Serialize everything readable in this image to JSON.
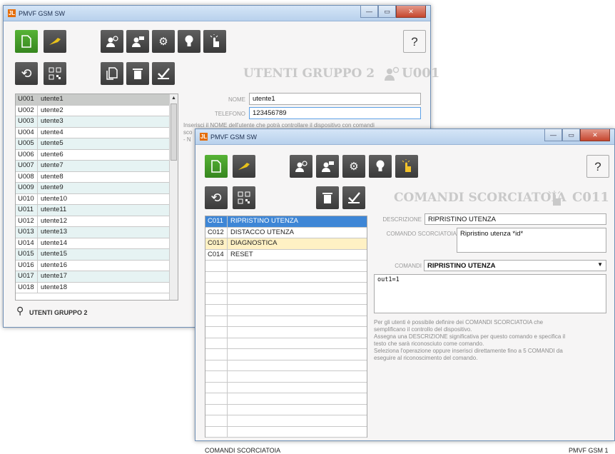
{
  "window1": {
    "title": "PMVF GSM SW",
    "section_title": "UTENTI GRUPPO 2",
    "section_code": "U001",
    "nome_label": "NOME",
    "nome_value": "utente1",
    "telefono_label": "TELEFONO",
    "telefono_value": "123456789",
    "hint_line1": "Inserisci il NOME dell'utente che potrà controllare il dispositivo con comandi",
    "hint_line2": "sco",
    "hint_line3": "- N",
    "footer": "UTENTI GRUPPO 2",
    "users": [
      {
        "code": "U001",
        "name": "utente1"
      },
      {
        "code": "U002",
        "name": "utente2"
      },
      {
        "code": "U003",
        "name": "utente3"
      },
      {
        "code": "U004",
        "name": "utente4"
      },
      {
        "code": "U005",
        "name": "utente5"
      },
      {
        "code": "U006",
        "name": "utente6"
      },
      {
        "code": "U007",
        "name": "utente7"
      },
      {
        "code": "U008",
        "name": "utente8"
      },
      {
        "code": "U009",
        "name": "utente9"
      },
      {
        "code": "U010",
        "name": "utente10"
      },
      {
        "code": "U011",
        "name": "utente11"
      },
      {
        "code": "U012",
        "name": "utente12"
      },
      {
        "code": "U013",
        "name": "utente13"
      },
      {
        "code": "U014",
        "name": "utente14"
      },
      {
        "code": "U015",
        "name": "utente15"
      },
      {
        "code": "U016",
        "name": "utente16"
      },
      {
        "code": "U017",
        "name": "utente17"
      },
      {
        "code": "U018",
        "name": "utente18"
      }
    ]
  },
  "window2": {
    "title": "PMVF GSM SW",
    "section_title": "COMANDI SCORCIATOIA",
    "section_code": "C011",
    "descrizione_label": "DESCRIZIONE",
    "descrizione_value": "RIPRISTINO UTENZA",
    "comando_label": "COMANDO SCORCIATOIA",
    "comando_value": "Ripristino utenza *id*",
    "comandi_label": "COMANDI",
    "comandi_value": "RIPRISTINO UTENZA",
    "commands_text": "out1=1",
    "info_lines": [
      "Per gli utenti è possibile definire dei COMANDI SCORCIATOIA che",
      "semplificano il controllo del dispositivo.",
      "Assegna una DESCRIZIONE significativa per questo comando e specifica il",
      "testo che sarà riconosciuto come comando.",
      "Seleziona l'operazione oppure inserisci direttamente fino a 5 COMANDI da",
      "eseguire al riconoscimento del comando."
    ],
    "footer_left": "COMANDI SCORCIATOIA",
    "footer_right": "PMVF GSM 1",
    "commands": [
      {
        "code": "C011",
        "name": "RIPRISTINO UTENZA"
      },
      {
        "code": "C012",
        "name": "DISTACCO UTENZA"
      },
      {
        "code": "C013",
        "name": "DIAGNOSTICA"
      },
      {
        "code": "C014",
        "name": "RESET"
      }
    ]
  },
  "colors": {
    "accent_green": "#3c9a24",
    "selected_blue": "#3e86d6",
    "selected_yellow": "#fff1c4",
    "title_gray": "#c9c9c9"
  }
}
